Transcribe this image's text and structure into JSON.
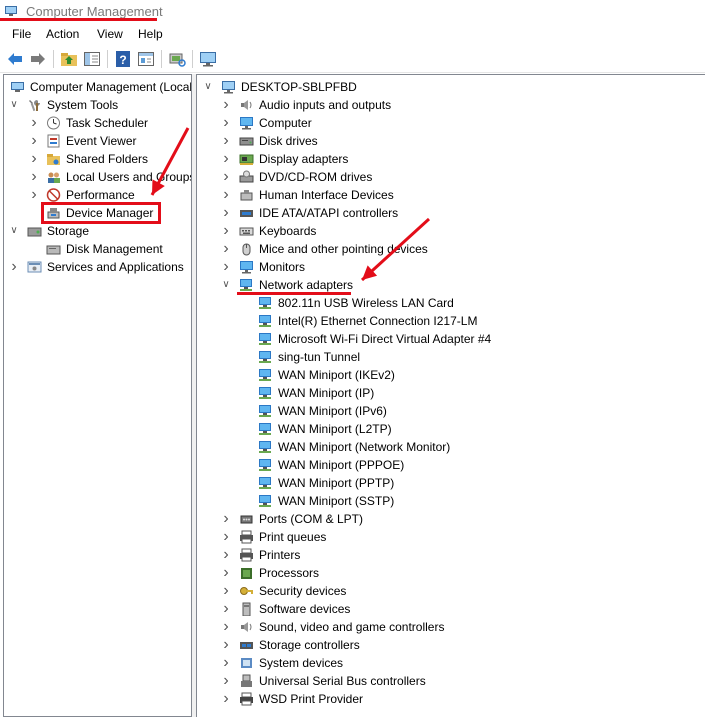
{
  "window": {
    "title": "Computer Management"
  },
  "menu": {
    "items": [
      "File",
      "Action",
      "View",
      "Help"
    ]
  },
  "toolbar": {
    "icons": [
      "back-arrow-icon",
      "forward-arrow-icon",
      "up-folder-icon",
      "show-hide-tree-icon",
      "help-icon",
      "properties-icon",
      "scan-hardware-icon",
      "monitor-icon"
    ]
  },
  "left_tree": {
    "items": [
      {
        "label": "Computer Management (Local",
        "icon": "computer-management-icon",
        "expander": "none"
      },
      {
        "label": "System Tools",
        "icon": "tools-icon",
        "expander": "expanded"
      },
      {
        "label": "Task Scheduler",
        "icon": "clock-icon",
        "expander": "collapsed"
      },
      {
        "label": "Event Viewer",
        "icon": "event-viewer-icon",
        "expander": "collapsed"
      },
      {
        "label": "Shared Folders",
        "icon": "shared-folder-icon",
        "expander": "collapsed"
      },
      {
        "label": "Local Users and Groups",
        "icon": "users-icon",
        "expander": "collapsed"
      },
      {
        "label": "Performance",
        "icon": "performance-icon",
        "expander": "collapsed"
      },
      {
        "label": "Device Manager",
        "icon": "device-manager-icon",
        "expander": "none",
        "highlighted": true
      },
      {
        "label": "Storage",
        "icon": "storage-icon",
        "expander": "expanded"
      },
      {
        "label": "Disk Management",
        "icon": "disk-icon",
        "expander": "none"
      },
      {
        "label": "Services and Applications",
        "icon": "services-icon",
        "expander": "collapsed"
      }
    ]
  },
  "right_tree": {
    "root": {
      "label": "DESKTOP-SBLPFBD",
      "icon": "computer-icon",
      "expander": "expanded"
    },
    "categories": [
      {
        "label": "Audio inputs and outputs",
        "icon": "speaker-icon",
        "expander": "collapsed"
      },
      {
        "label": "Computer",
        "icon": "monitor-icon",
        "expander": "collapsed"
      },
      {
        "label": "Disk drives",
        "icon": "disk-drive-icon",
        "expander": "collapsed"
      },
      {
        "label": "Display adapters",
        "icon": "display-adapter-icon",
        "expander": "collapsed"
      },
      {
        "label": "DVD/CD-ROM drives",
        "icon": "dvd-icon",
        "expander": "collapsed"
      },
      {
        "label": "Human Interface Devices",
        "icon": "hid-icon",
        "expander": "collapsed"
      },
      {
        "label": "IDE ATA/ATAPI controllers",
        "icon": "ide-controller-icon",
        "expander": "collapsed"
      },
      {
        "label": "Keyboards",
        "icon": "keyboard-icon",
        "expander": "collapsed"
      },
      {
        "label": "Mice and other pointing devices",
        "icon": "mouse-icon",
        "expander": "collapsed"
      },
      {
        "label": "Monitors",
        "icon": "monitor-icon",
        "expander": "collapsed"
      },
      {
        "label": "Network adapters",
        "icon": "network-adapter-icon",
        "expander": "expanded",
        "highlighted": true,
        "children": [
          "802.11n USB Wireless LAN Card",
          "Intel(R) Ethernet Connection I217-LM",
          "Microsoft Wi-Fi Direct Virtual Adapter #4",
          "sing-tun Tunnel",
          "WAN Miniport (IKEv2)",
          "WAN Miniport (IP)",
          "WAN Miniport (IPv6)",
          "WAN Miniport (L2TP)",
          "WAN Miniport (Network Monitor)",
          "WAN Miniport (PPPOE)",
          "WAN Miniport (PPTP)",
          "WAN Miniport (SSTP)"
        ]
      },
      {
        "label": "Ports (COM & LPT)",
        "icon": "port-icon",
        "expander": "collapsed"
      },
      {
        "label": "Print queues",
        "icon": "printer-icon",
        "expander": "collapsed"
      },
      {
        "label": "Printers",
        "icon": "printer-icon",
        "expander": "collapsed"
      },
      {
        "label": "Processors",
        "icon": "processor-icon",
        "expander": "collapsed"
      },
      {
        "label": "Security devices",
        "icon": "security-key-icon",
        "expander": "collapsed"
      },
      {
        "label": "Software devices",
        "icon": "software-device-icon",
        "expander": "collapsed"
      },
      {
        "label": "Sound, video and game controllers",
        "icon": "sound-icon",
        "expander": "collapsed"
      },
      {
        "label": "Storage controllers",
        "icon": "storage-controller-icon",
        "expander": "collapsed"
      },
      {
        "label": "System devices",
        "icon": "system-device-icon",
        "expander": "collapsed"
      },
      {
        "label": "Universal Serial Bus controllers",
        "icon": "usb-icon",
        "expander": "collapsed"
      },
      {
        "label": "WSD Print Provider",
        "icon": "wsd-printer-icon",
        "expander": "collapsed"
      }
    ]
  },
  "colors": {
    "annotation_red": "#e30d19",
    "network_icon_blue": "#2b9be0",
    "title_gray": "#7a7a7a"
  }
}
